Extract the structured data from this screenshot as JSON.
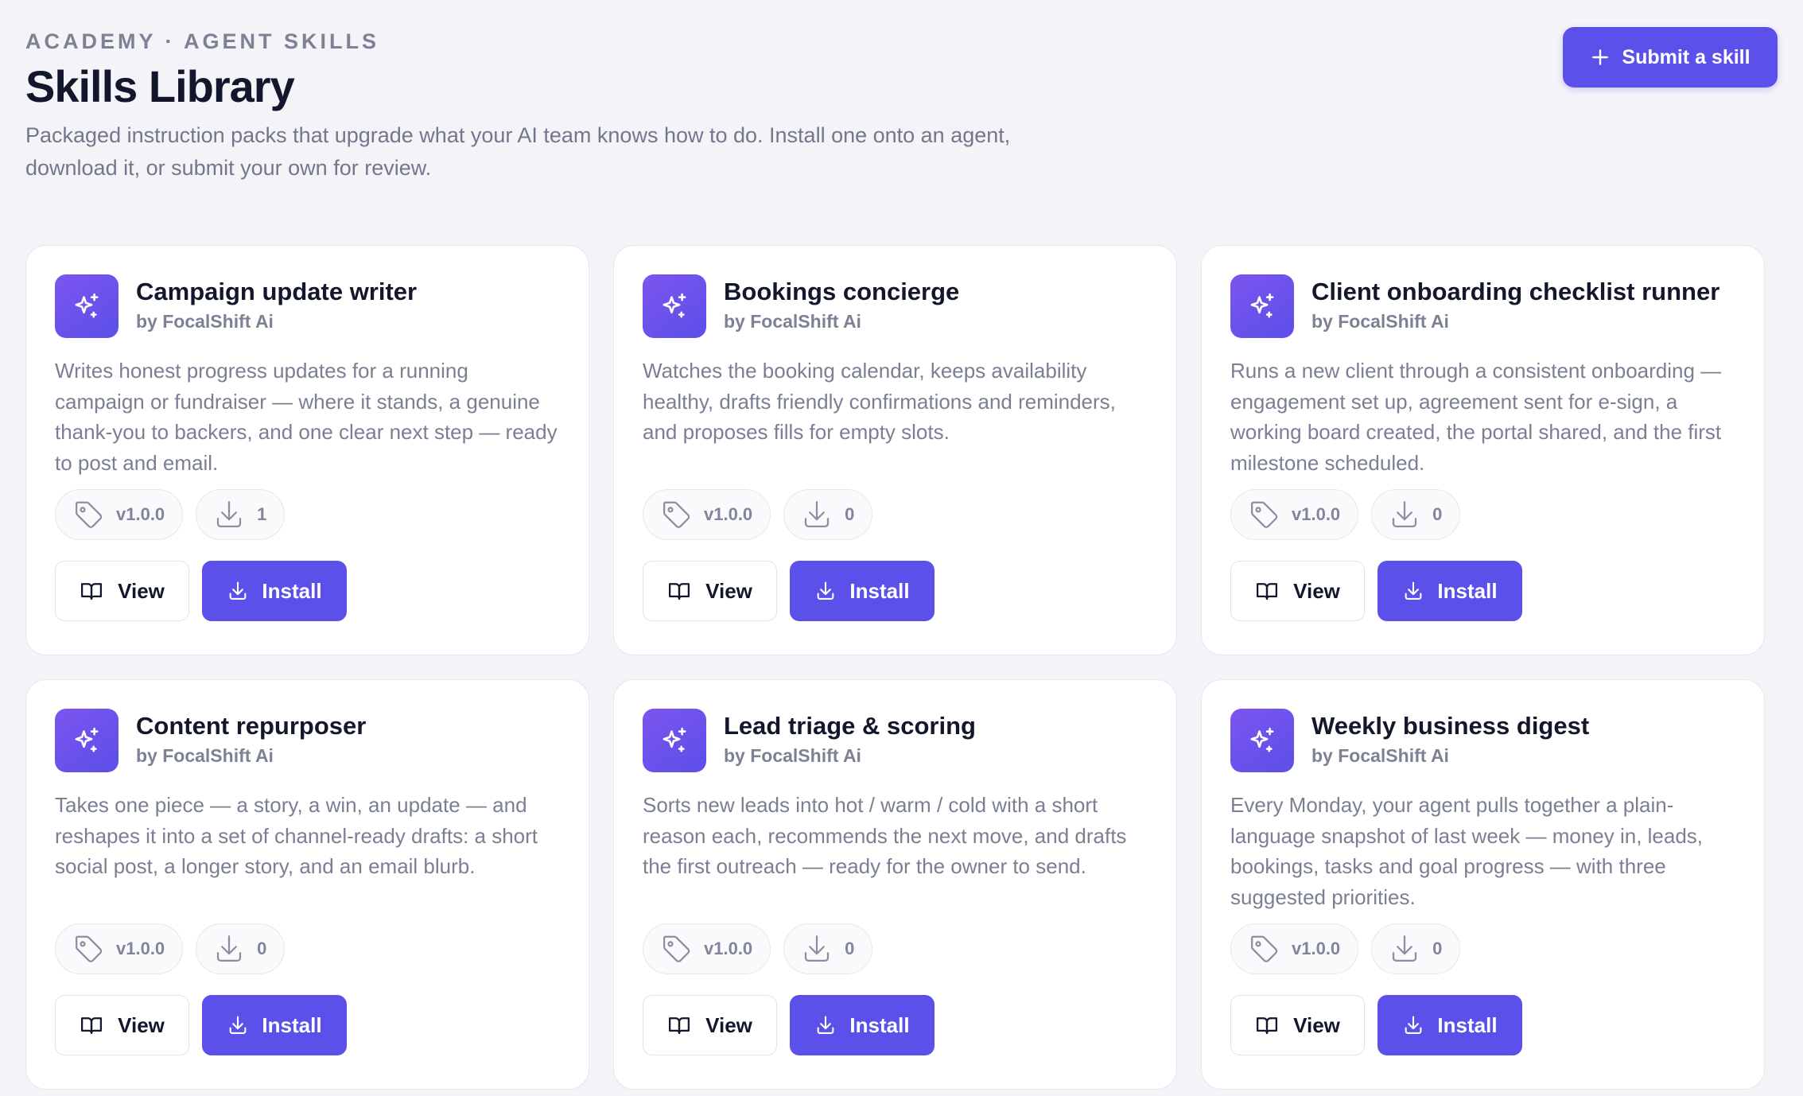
{
  "header": {
    "eyebrow": "ACADEMY · AGENT SKILLS",
    "title": "Skills Library",
    "subtitle": "Packaged instruction packs that upgrade what your AI team knows how to do. Install one onto an agent, download it, or submit your own for review.",
    "submit_label": "Submit a skill"
  },
  "colors": {
    "accent": "#5b51ea",
    "background": "#f3f3f8",
    "card": "#ffffff",
    "muted_text": "#7a7f93"
  },
  "icons": {
    "skill": "sparkles-icon",
    "version": "tag-icon",
    "downloads": "download-icon",
    "view": "book-open-icon",
    "install": "download-icon",
    "submit": "plus-icon"
  },
  "buttons": {
    "view_label": "View",
    "install_label": "Install"
  },
  "skills": [
    {
      "title": "Campaign update writer",
      "author": "by FocalShift Ai",
      "description": "Writes honest progress updates for a running campaign or fundraiser — where it stands, a genuine thank-you to backers, and one clear next step — ready to post and email.",
      "version": "v1.0.0",
      "downloads": "1"
    },
    {
      "title": "Bookings concierge",
      "author": "by FocalShift Ai",
      "description": "Watches the booking calendar, keeps availability healthy, drafts friendly confirmations and reminders, and proposes fills for empty slots.",
      "version": "v1.0.0",
      "downloads": "0"
    },
    {
      "title": "Client onboarding checklist runner",
      "author": "by FocalShift Ai",
      "description": "Runs a new client through a consistent onboarding — engagement set up, agreement sent for e-sign, a working board created, the portal shared, and the first milestone scheduled.",
      "version": "v1.0.0",
      "downloads": "0"
    },
    {
      "title": "Content repurposer",
      "author": "by FocalShift Ai",
      "description": "Takes one piece — a story, a win, an update — and reshapes it into a set of channel-ready drafts: a short social post, a longer story, and an email blurb.",
      "version": "v1.0.0",
      "downloads": "0"
    },
    {
      "title": "Lead triage & scoring",
      "author": "by FocalShift Ai",
      "description": "Sorts new leads into hot / warm / cold with a short reason each, recommends the next move, and drafts the first outreach — ready for the owner to send.",
      "version": "v1.0.0",
      "downloads": "0"
    },
    {
      "title": "Weekly business digest",
      "author": "by FocalShift Ai",
      "description": "Every Monday, your agent pulls together a plain-language snapshot of last week — money in, leads, bookings, tasks and goal progress — with three suggested priorities.",
      "version": "v1.0.0",
      "downloads": "0"
    }
  ]
}
